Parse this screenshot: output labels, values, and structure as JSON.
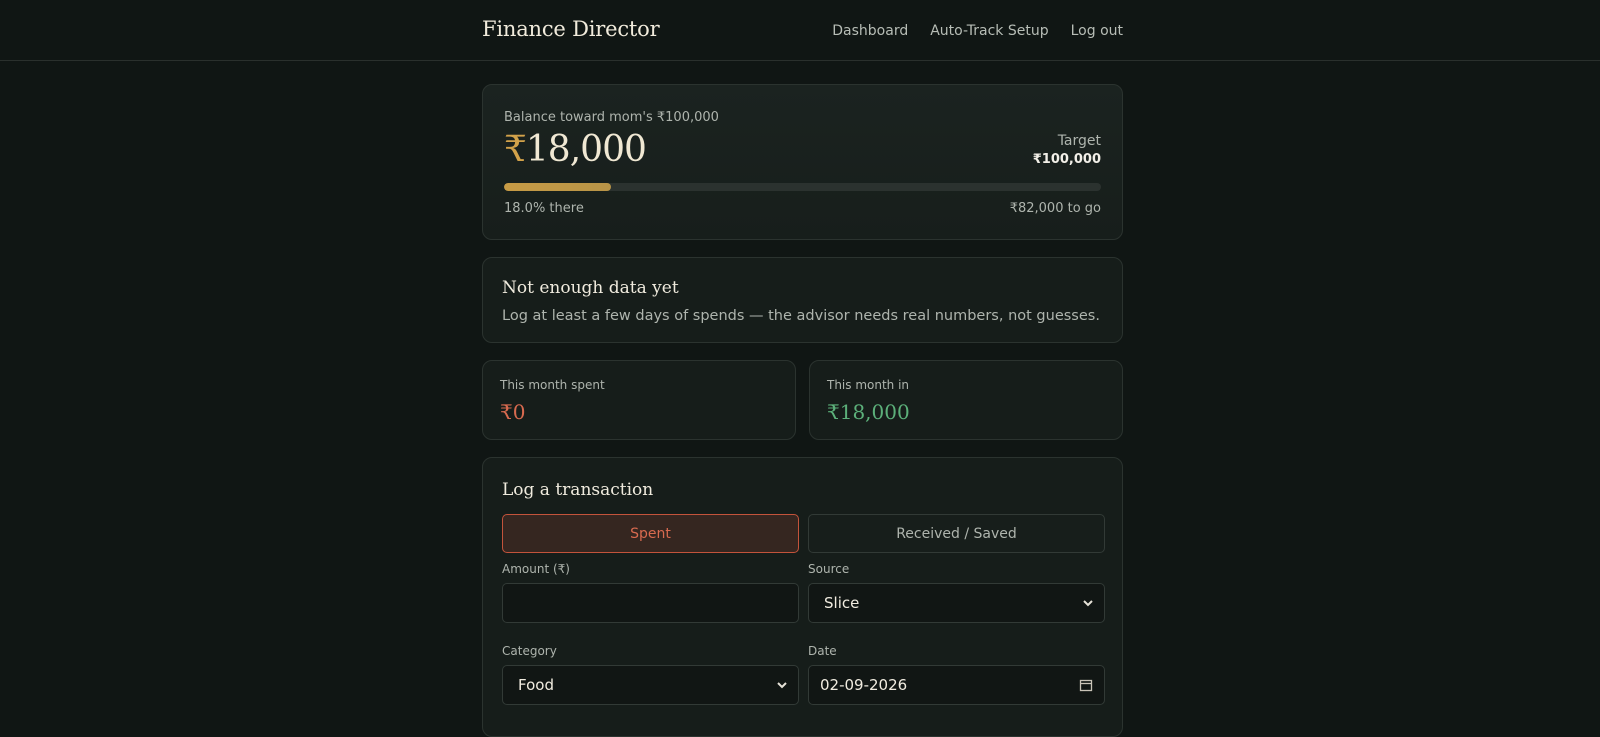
{
  "header": {
    "brand": "Finance Director",
    "nav": [
      "Dashboard",
      "Auto-Track Setup",
      "Log out"
    ]
  },
  "balance": {
    "label": "Balance toward mom's ₹100,000",
    "currency_symbol": "₹",
    "amount": "18,000",
    "target_label": "Target",
    "target_value": "₹100,000",
    "progress_fraction": 0.18,
    "progress_text": "18.0% there",
    "remaining_text": "₹82,000 to go"
  },
  "advisor": {
    "title": "Not enough data yet",
    "message": "Log at least a few days of spends — the advisor needs real numbers, not guesses."
  },
  "stats": {
    "spent_label": "This month spent",
    "spent_value": "₹0",
    "in_label": "This month in",
    "in_value": "₹18,000"
  },
  "log_form": {
    "title": "Log a transaction",
    "toggle_spent": "Spent",
    "toggle_received": "Received / Saved",
    "amount_label": "Amount (₹)",
    "amount_value": "",
    "source_label": "Source",
    "source_value": "Slice",
    "category_label": "Category",
    "category_value": "Food",
    "date_label": "Date",
    "date_value": "02-09-2026"
  },
  "colors": {
    "background": "#101614",
    "accent_gold": "#d2a24a",
    "spent_red": "#d86a4f",
    "in_green": "#5cb07a"
  },
  "icons": [
    "chevron-down-icon",
    "calendar-icon"
  ]
}
